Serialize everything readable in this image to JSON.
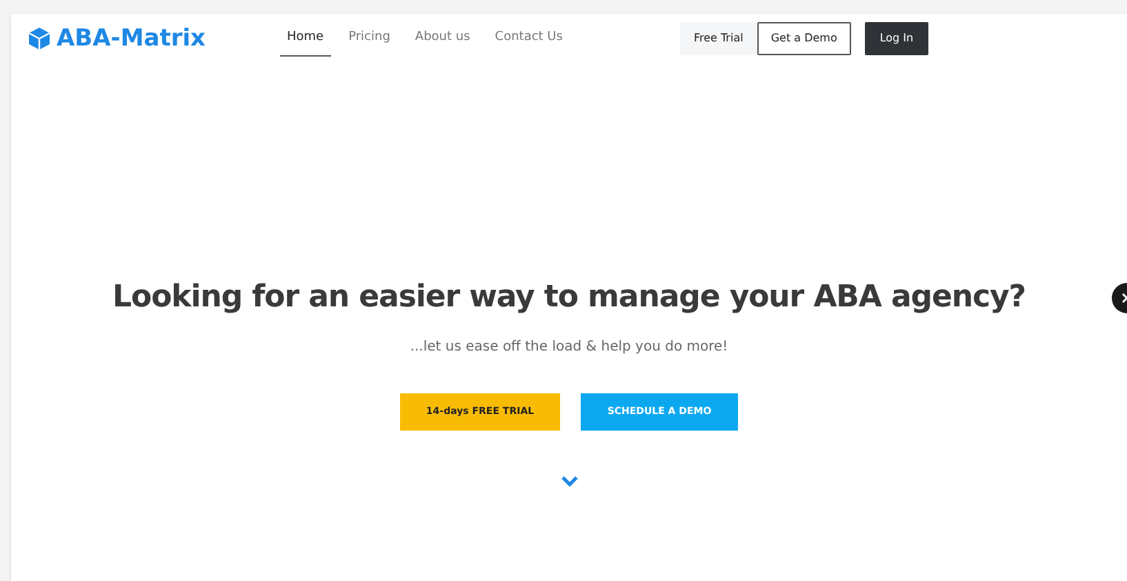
{
  "logo": {
    "text": "ABA-Matrix"
  },
  "nav": [
    {
      "label": "Home",
      "selected": true
    },
    {
      "label": "Pricing",
      "selected": false
    },
    {
      "label": "About us",
      "selected": false
    },
    {
      "label": "Contact Us",
      "selected": false
    }
  ],
  "header_buttons": [
    {
      "label": "Free Trial",
      "kind": "light"
    },
    {
      "label": "Get a Demo",
      "kind": "outline"
    },
    {
      "label": "Log In",
      "kind": "dark"
    }
  ],
  "hero": {
    "title": "Looking for an easier way to manage your ABA agency?",
    "subtitle": "...let us ease off the load & help you do more!",
    "buttons": [
      {
        "label": "14-days FREE TRIAL",
        "kind": "yellow"
      },
      {
        "label": "SCHEDULE A DEMO",
        "kind": "blue"
      }
    ]
  }
}
